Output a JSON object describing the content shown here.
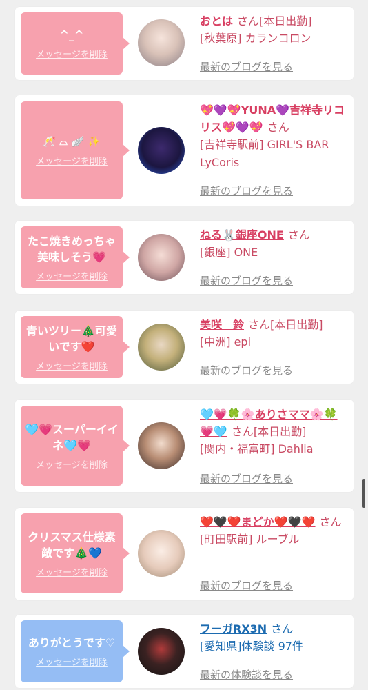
{
  "delete_label": "メッセージを削除",
  "san": "さん",
  "items": [
    {
      "bubble_text": "^_^",
      "name": "おとは",
      "after_san": "[本日出勤]",
      "meta": "[秋葉原] カランコロン",
      "blog_link": "最新のブログを見る"
    },
    {
      "bubble_text": "🥂 ⌓ 🪽 ✨",
      "name": "💖💜💖YUNA💜吉祥寺リコリス💖💜💖",
      "after_san": "",
      "meta": "[吉祥寺駅前] GIRL'S BAR LyCoris",
      "blog_link": "最新のブログを見る"
    },
    {
      "bubble_text": "たこ焼きめっちゃ美味しそう💗",
      "name": "ねる🐰銀座ONE",
      "after_san": "",
      "meta": "[銀座] ONE",
      "blog_link": "最新のブログを見る"
    },
    {
      "bubble_text": "青いツリー🎄可愛いです❤️",
      "name": "美咲　鈴",
      "after_san": "[本日出勤]",
      "meta": "[中洲] epi",
      "blog_link": "最新のブログを見る"
    },
    {
      "bubble_text": "🩵💗スーパーイイネ🩵💗",
      "name": "🩵💗🍀🌸ありさママ🌸🍀💗🩵",
      "after_san": "[本日出勤]",
      "meta": "[関内・福富町] Dahlia",
      "blog_link": "最新のブログを見る"
    },
    {
      "bubble_text": "クリスマス仕様素敵です🎄💙",
      "name": "❤️🖤❤️まどか❤️🖤❤️",
      "after_san": "",
      "meta": "[町田駅前] ルーブル",
      "blog_link": "最新のブログを見る"
    },
    {
      "bubble_text": "ありがとうです♡",
      "name": "フーガRX3N",
      "after_san": "",
      "meta": "[愛知県]体験談 97件",
      "blog_link": "最新の体験談を見る"
    }
  ]
}
